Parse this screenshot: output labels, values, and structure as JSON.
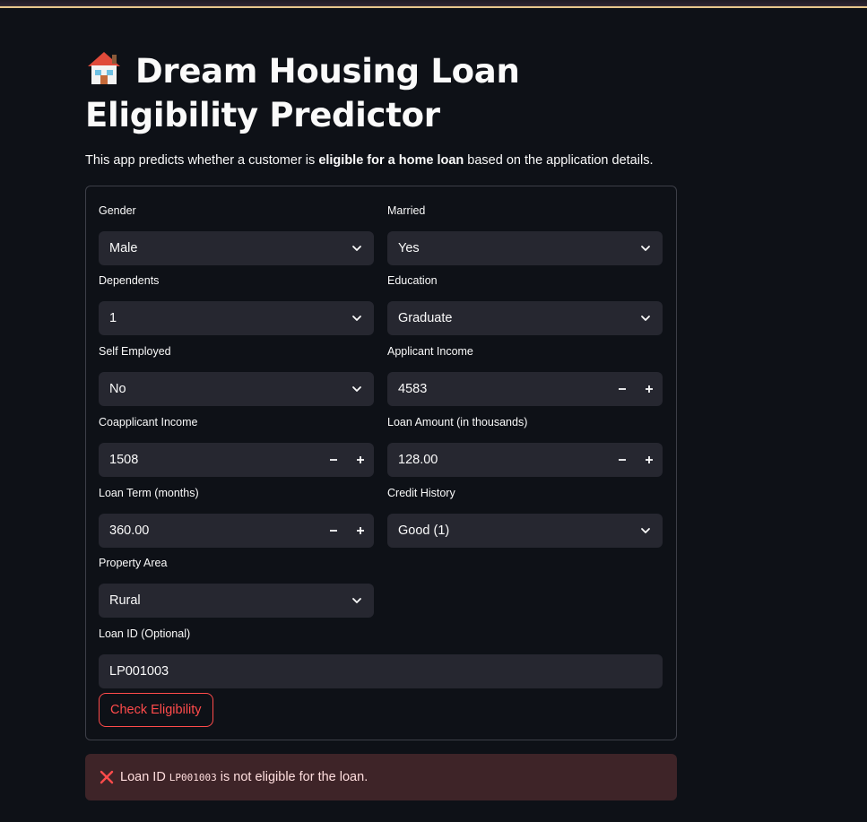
{
  "page": {
    "title": "Dream Housing Loan Eligibility Predictor",
    "subtitle_pre": "This app predicts whether a customer is ",
    "subtitle_bold": "eligible for a home loan",
    "subtitle_post": " based on the application details."
  },
  "form": {
    "gender": {
      "label": "Gender",
      "value": "Male"
    },
    "married": {
      "label": "Married",
      "value": "Yes"
    },
    "dependents": {
      "label": "Dependents",
      "value": "1"
    },
    "education": {
      "label": "Education",
      "value": "Graduate"
    },
    "self_employed": {
      "label": "Self Employed",
      "value": "No"
    },
    "applicant_income": {
      "label": "Applicant Income",
      "value": "4583"
    },
    "coapplicant_income": {
      "label": "Coapplicant Income",
      "value": "1508"
    },
    "loan_amount": {
      "label": "Loan Amount (in thousands)",
      "value": "128.00"
    },
    "loan_term": {
      "label": "Loan Term (months)",
      "value": "360.00"
    },
    "credit_history": {
      "label": "Credit History",
      "value": "Good (1)"
    },
    "property_area": {
      "label": "Property Area",
      "value": "Rural"
    },
    "loan_id": {
      "label": "Loan ID (Optional)",
      "value": "LP001003"
    },
    "submit_label": "Check Eligibility"
  },
  "result": {
    "pre": "Loan ID",
    "loan_id": "LP001003",
    "post": "is not eligible for the loan."
  },
  "icons": {
    "title_icon": "house-icon",
    "select_icon": "chevron-down-icon",
    "minus_icon": "minus-icon",
    "plus_icon": "plus-icon",
    "error_icon": "x-icon"
  },
  "colors": {
    "background": "#0e1117",
    "input_bg": "#262730",
    "accent": "#ff4b4b",
    "error_bg": "#3e2428"
  }
}
